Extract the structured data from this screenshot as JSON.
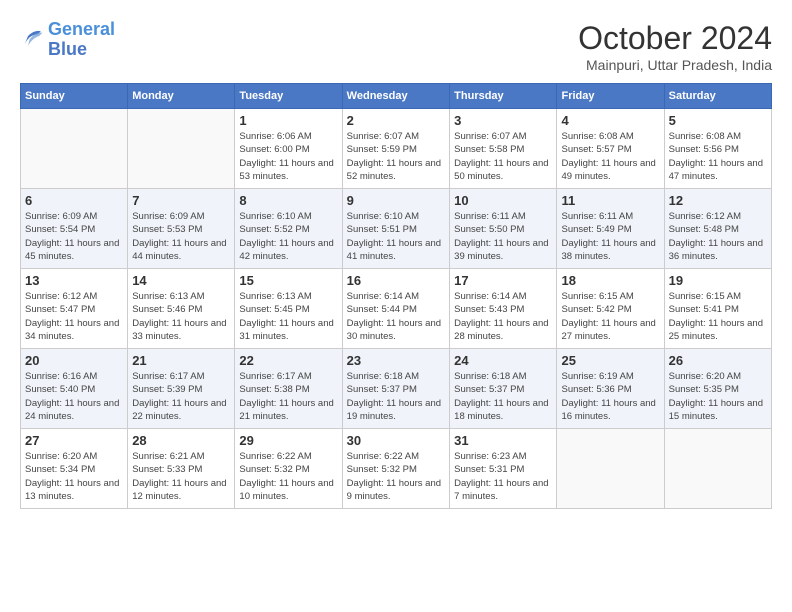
{
  "header": {
    "logo_line1": "General",
    "logo_line2": "Blue",
    "month": "October 2024",
    "location": "Mainpuri, Uttar Pradesh, India"
  },
  "weekdays": [
    "Sunday",
    "Monday",
    "Tuesday",
    "Wednesday",
    "Thursday",
    "Friday",
    "Saturday"
  ],
  "weeks": [
    [
      {
        "day": "",
        "info": ""
      },
      {
        "day": "",
        "info": ""
      },
      {
        "day": "1",
        "info": "Sunrise: 6:06 AM\nSunset: 6:00 PM\nDaylight: 11 hours and 53 minutes."
      },
      {
        "day": "2",
        "info": "Sunrise: 6:07 AM\nSunset: 5:59 PM\nDaylight: 11 hours and 52 minutes."
      },
      {
        "day": "3",
        "info": "Sunrise: 6:07 AM\nSunset: 5:58 PM\nDaylight: 11 hours and 50 minutes."
      },
      {
        "day": "4",
        "info": "Sunrise: 6:08 AM\nSunset: 5:57 PM\nDaylight: 11 hours and 49 minutes."
      },
      {
        "day": "5",
        "info": "Sunrise: 6:08 AM\nSunset: 5:56 PM\nDaylight: 11 hours and 47 minutes."
      }
    ],
    [
      {
        "day": "6",
        "info": "Sunrise: 6:09 AM\nSunset: 5:54 PM\nDaylight: 11 hours and 45 minutes."
      },
      {
        "day": "7",
        "info": "Sunrise: 6:09 AM\nSunset: 5:53 PM\nDaylight: 11 hours and 44 minutes."
      },
      {
        "day": "8",
        "info": "Sunrise: 6:10 AM\nSunset: 5:52 PM\nDaylight: 11 hours and 42 minutes."
      },
      {
        "day": "9",
        "info": "Sunrise: 6:10 AM\nSunset: 5:51 PM\nDaylight: 11 hours and 41 minutes."
      },
      {
        "day": "10",
        "info": "Sunrise: 6:11 AM\nSunset: 5:50 PM\nDaylight: 11 hours and 39 minutes."
      },
      {
        "day": "11",
        "info": "Sunrise: 6:11 AM\nSunset: 5:49 PM\nDaylight: 11 hours and 38 minutes."
      },
      {
        "day": "12",
        "info": "Sunrise: 6:12 AM\nSunset: 5:48 PM\nDaylight: 11 hours and 36 minutes."
      }
    ],
    [
      {
        "day": "13",
        "info": "Sunrise: 6:12 AM\nSunset: 5:47 PM\nDaylight: 11 hours and 34 minutes."
      },
      {
        "day": "14",
        "info": "Sunrise: 6:13 AM\nSunset: 5:46 PM\nDaylight: 11 hours and 33 minutes."
      },
      {
        "day": "15",
        "info": "Sunrise: 6:13 AM\nSunset: 5:45 PM\nDaylight: 11 hours and 31 minutes."
      },
      {
        "day": "16",
        "info": "Sunrise: 6:14 AM\nSunset: 5:44 PM\nDaylight: 11 hours and 30 minutes."
      },
      {
        "day": "17",
        "info": "Sunrise: 6:14 AM\nSunset: 5:43 PM\nDaylight: 11 hours and 28 minutes."
      },
      {
        "day": "18",
        "info": "Sunrise: 6:15 AM\nSunset: 5:42 PM\nDaylight: 11 hours and 27 minutes."
      },
      {
        "day": "19",
        "info": "Sunrise: 6:15 AM\nSunset: 5:41 PM\nDaylight: 11 hours and 25 minutes."
      }
    ],
    [
      {
        "day": "20",
        "info": "Sunrise: 6:16 AM\nSunset: 5:40 PM\nDaylight: 11 hours and 24 minutes."
      },
      {
        "day": "21",
        "info": "Sunrise: 6:17 AM\nSunset: 5:39 PM\nDaylight: 11 hours and 22 minutes."
      },
      {
        "day": "22",
        "info": "Sunrise: 6:17 AM\nSunset: 5:38 PM\nDaylight: 11 hours and 21 minutes."
      },
      {
        "day": "23",
        "info": "Sunrise: 6:18 AM\nSunset: 5:37 PM\nDaylight: 11 hours and 19 minutes."
      },
      {
        "day": "24",
        "info": "Sunrise: 6:18 AM\nSunset: 5:37 PM\nDaylight: 11 hours and 18 minutes."
      },
      {
        "day": "25",
        "info": "Sunrise: 6:19 AM\nSunset: 5:36 PM\nDaylight: 11 hours and 16 minutes."
      },
      {
        "day": "26",
        "info": "Sunrise: 6:20 AM\nSunset: 5:35 PM\nDaylight: 11 hours and 15 minutes."
      }
    ],
    [
      {
        "day": "27",
        "info": "Sunrise: 6:20 AM\nSunset: 5:34 PM\nDaylight: 11 hours and 13 minutes."
      },
      {
        "day": "28",
        "info": "Sunrise: 6:21 AM\nSunset: 5:33 PM\nDaylight: 11 hours and 12 minutes."
      },
      {
        "day": "29",
        "info": "Sunrise: 6:22 AM\nSunset: 5:32 PM\nDaylight: 11 hours and 10 minutes."
      },
      {
        "day": "30",
        "info": "Sunrise: 6:22 AM\nSunset: 5:32 PM\nDaylight: 11 hours and 9 minutes."
      },
      {
        "day": "31",
        "info": "Sunrise: 6:23 AM\nSunset: 5:31 PM\nDaylight: 11 hours and 7 minutes."
      },
      {
        "day": "",
        "info": ""
      },
      {
        "day": "",
        "info": ""
      }
    ]
  ]
}
